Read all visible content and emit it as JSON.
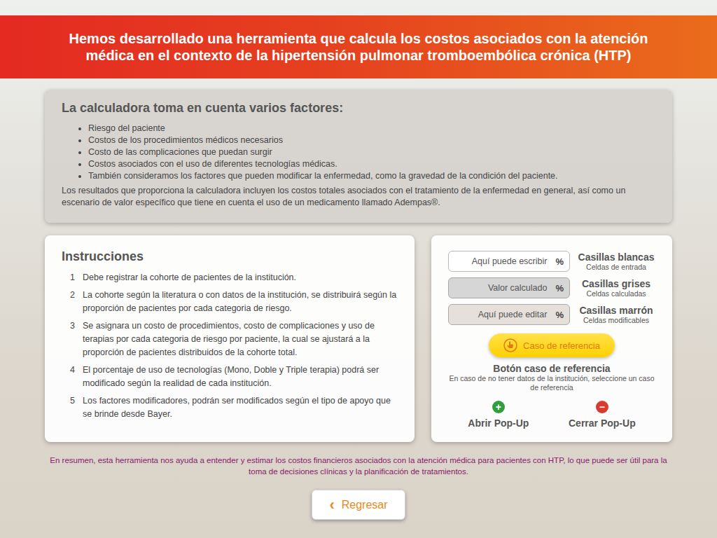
{
  "header": {
    "title": "Hemos desarrollado una herramienta que calcula los costos asociados con la atención médica en el contexto de la hipertensión pulmonar tromboembólica crónica (HTP)"
  },
  "factors": {
    "title": "La calculadora toma en cuenta varios factores:",
    "items": [
      "Riesgo del paciente",
      "Costos de los procedimientos médicos necesarios",
      "Costo de las complicaciones que puedan surgir",
      "Costos asociados con el uso de diferentes tecnologías médicas.",
      "También consideramos los factores que pueden modificar la enfermedad, como la gravedad de la condición del paciente."
    ],
    "summary": "Los resultados que proporciona la calculadora incluyen los costos totales asociados con el tratamiento de la enfermedad en general, así como un escenario de valor específico que tiene en cuenta el uso de un medicamento llamado Adempas®."
  },
  "instructions": {
    "title": "Instrucciones",
    "steps": [
      {
        "number": "1",
        "text": "Debe registrar la cohorte de pacientes de la institución."
      },
      {
        "number": "2",
        "text": "La cohorte según la literatura o con datos de la institución, se distribuirá según la proporción de pacientes por cada categoria de riesgo."
      },
      {
        "number": "3",
        "text": "Se asignara un costo de procedimientos, costo de complicaciones y uso de terapias por cada categoria de riesgo por paciente, la cual se ajustará a la proporción de pacientes distribuidos de la cohorte total."
      },
      {
        "number": "4",
        "text": "El porcentaje de uso de tecnologías (Mono, Doble y Triple terapia) podrá ser modificado según la realidad de cada institución."
      },
      {
        "number": "5",
        "text": "Los factores modificadores, podrán ser modificados según el tipo de apoyo que se brinde desde Bayer."
      }
    ]
  },
  "legend": {
    "cells": [
      {
        "kind": "input",
        "field_text": "Aquí puede escribir",
        "unit": "%",
        "label": "Casillas blancas",
        "caption": "Celdas de entrada"
      },
      {
        "kind": "calculated",
        "field_text": "Valor calculado",
        "unit": "%",
        "label": "Casillas grises",
        "caption": "Celdas calculadas"
      },
      {
        "kind": "editable",
        "field_text": "Aquí puede editar",
        "unit": "%",
        "label": "Casillas marrón",
        "caption": "Celdas modificables"
      }
    ],
    "reference": {
      "button": "Caso de referencia",
      "title": "Botón caso de referencia",
      "caption": "En caso de no tener datos de la institución, seleccione un caso de referencia"
    },
    "popups": [
      {
        "kind": "open",
        "symbol": "+",
        "label": "Abrir Pop-Up",
        "color": "#2f9e3c"
      },
      {
        "kind": "close",
        "symbol": "−",
        "label": "Cerrar Pop-Up",
        "color": "#d83a2e"
      }
    ]
  },
  "footer": {
    "summary": "En resumen, esta herramienta nos ayuda a entender y estimar los costos financieros asociados con la atención médica para pacientes con HTP, lo que puede ser útil para la toma de decisiones clínicas y la planificación de tratamientos."
  },
  "back_button": {
    "symbol": "‹",
    "label": "Regresar"
  }
}
